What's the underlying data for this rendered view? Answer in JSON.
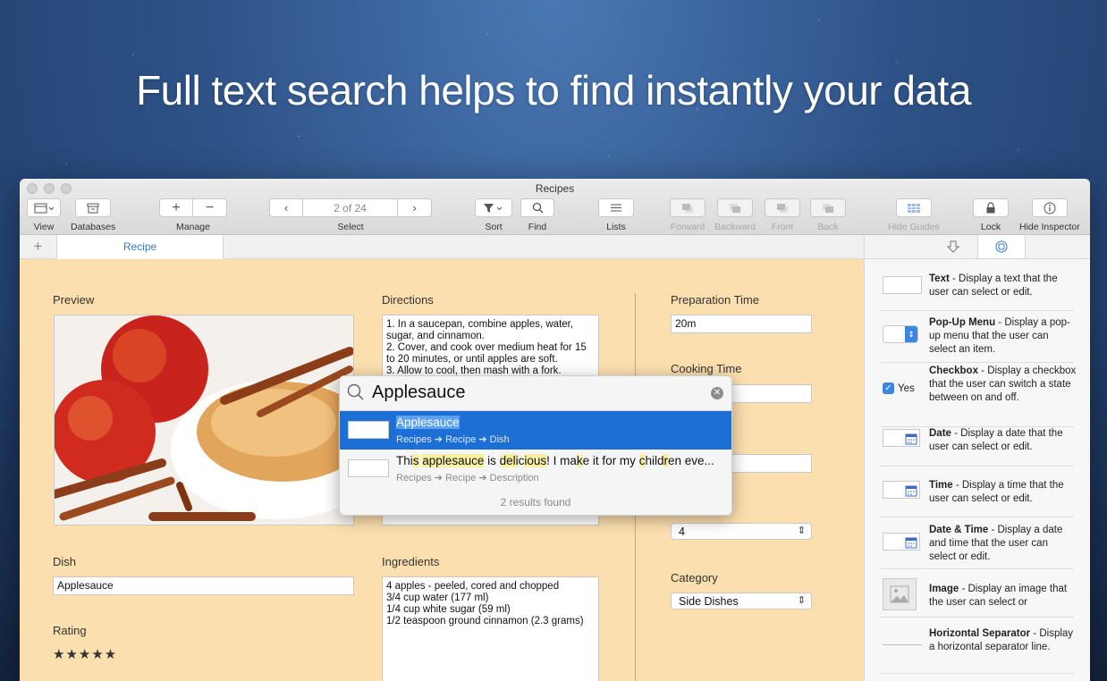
{
  "headline": "Full text search helps to find instantly your data",
  "window": {
    "title": "Recipes"
  },
  "toolbar": {
    "view": "View",
    "databases": "Databases",
    "manage": "Manage",
    "record_counter": "2 of 24",
    "select": "Select",
    "sort": "Sort",
    "find": "Find",
    "lists": "Lists",
    "forward": "Forward",
    "backward": "Backward",
    "front": "Front",
    "back": "Back",
    "hide_guides": "Hide Guides",
    "lock": "Lock",
    "hide_inspector": "Hide Inspector"
  },
  "tabs": {
    "add": "+",
    "recipe": "Recipe"
  },
  "form": {
    "preview_label": "Preview",
    "directions_label": "Directions",
    "directions_text": "1. In a saucepan, combine apples, water, sugar, and cinnamon.\n2. Cover, and cook over medium heat for 15 to 20 minutes, or until apples are soft.\n3. Allow to cool, then mash with a fork.",
    "prep_label": "Preparation Time",
    "prep_value": "20m",
    "cooking_label": "Cooking Time",
    "servings_value": "4",
    "category_label": "Category",
    "category_value": "Side Dishes",
    "dish_label": "Dish",
    "dish_value": "Applesauce",
    "rating_label": "Rating",
    "rating_value": "★★★★★",
    "ingredients_label": "Ingredients",
    "ingredients_text": "4 apples - peeled, cored and chopped\n3/4 cup water (177 ml)\n1/4 cup white sugar (59 ml)\n1/2 teaspoon ground cinnamon (2.3 grams)"
  },
  "search": {
    "query": "Applesauce",
    "results": [
      {
        "title": "Applesauce",
        "path": "Recipes ➔ Recipe ➔ Dish"
      },
      {
        "title_parts": [
          "Thi",
          "s",
          " ",
          "applesauce",
          " is ",
          "deli",
          "c",
          "ious",
          "! I ",
          "ma",
          "k",
          "e it for my ",
          "c",
          "hild",
          "r",
          "en eve..."
        ],
        "path": "Recipes ➔ Recipe ➔ Description"
      }
    ],
    "count": "2 results found"
  },
  "inspector": {
    "items": [
      {
        "name": "Text",
        "desc": " - Display a text that the user can select or edit."
      },
      {
        "name": "Pop-Up Menu",
        "desc": " - Display a pop-up menu that the user can select an item."
      },
      {
        "name": "Checkbox",
        "desc": " - Display a checkbox that the user can switch a state between on and off.",
        "widget_label": "Yes"
      },
      {
        "name": "Date",
        "desc": " - Display a date that the user can select or edit."
      },
      {
        "name": "Time",
        "desc": " - Display a time that the user can select or edit."
      },
      {
        "name": "Date & Time",
        "desc": " - Display a date and time that the user can select or edit."
      },
      {
        "name": "Image",
        "desc": " - Display an image that the user can select or"
      },
      {
        "name": "Horizontal Separator",
        "desc": " - Display a horizontal separator line."
      }
    ]
  },
  "colors": {
    "accent": "#2f7ad8",
    "canvas": "#fbdfae",
    "selection": "#1d6fd6",
    "highlight": "#f7f0a2"
  }
}
